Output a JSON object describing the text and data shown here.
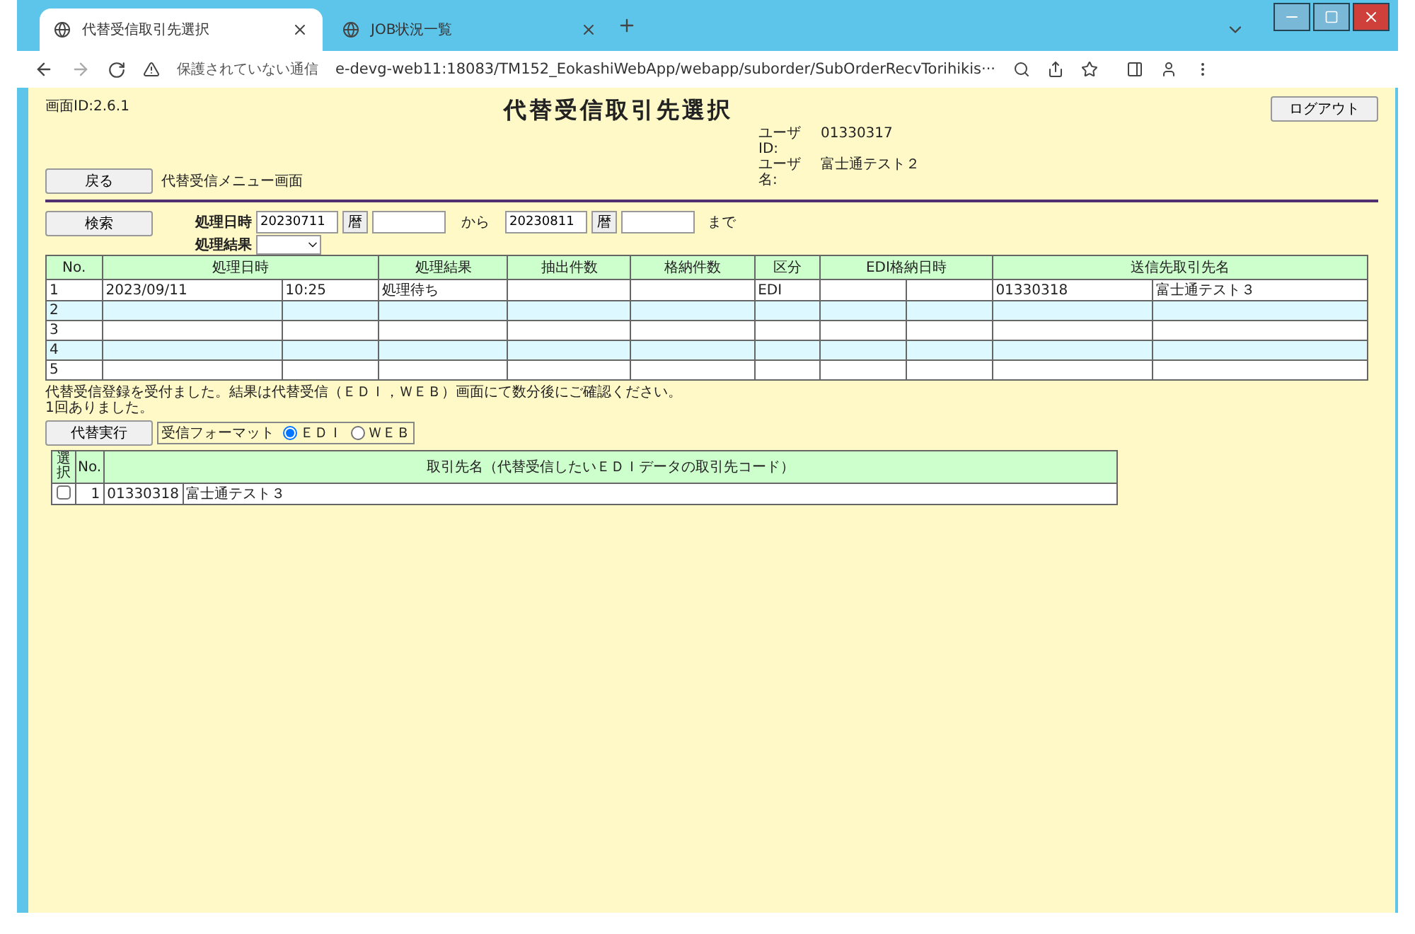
{
  "browser": {
    "tabs": [
      {
        "title": "代替受信取引先選択",
        "selected": true
      },
      {
        "title": "JOB状況一覧",
        "selected": false
      }
    ],
    "address": {
      "warning": "保護されていない通信",
      "url": "e-devg-web11:18083/TM152_EokashiWebApp/webapp/suborder/SubOrderRecvTorihikis···"
    }
  },
  "page": {
    "screen_id": "画面ID:2.6.1",
    "title": "代替受信取引先選択",
    "logout": "ログアウト",
    "user": [
      {
        "label": "ユーザID:",
        "value": "01330317"
      },
      {
        "label": "ユーザ名:",
        "value": "富士通テスト２"
      }
    ],
    "back": {
      "button": "戻る",
      "label": "代替受信メニュー画面"
    },
    "search": {
      "button": "検索",
      "date_label": "処理日時",
      "from": "20230711",
      "calendar": [
        "暦",
        "暦"
      ],
      "from_word": "から",
      "to": "20230811",
      "to_word": "まで",
      "result_label": "処理結果"
    },
    "jobs": {
      "columns": [
        "No.",
        "処理日時",
        "処理結果",
        "抽出件数",
        "格納件数",
        "区分",
        "EDI格納日時",
        "送信先取引先名"
      ],
      "rows": [
        {
          "no": "1",
          "date": "2023/09/11",
          "time": "10:25",
          "result": "処理待ち",
          "kind": "EDI",
          "code": "01330318",
          "name": "富士通テスト３"
        },
        {
          "no": "2"
        },
        {
          "no": "3"
        },
        {
          "no": "4"
        },
        {
          "no": "5"
        }
      ]
    },
    "messages": [
      "代替受信登録を受付ました。結果は代替受信（ＥＤＩ，ＷＥＢ）画面にて数分後にご確認ください。",
      "1回ありました。"
    ],
    "execute": "代替実行",
    "format_label": "受信フォーマット",
    "formats": [
      {
        "label": "ＥＤＩ",
        "selected": true
      },
      {
        "label": "ＷＥＢ",
        "selected": false
      }
    ],
    "partners": {
      "columns": [
        "選択",
        "No.",
        "取引先名（代替受信したいＥＤＩデータの取引先コード）"
      ],
      "rows": [
        {
          "checked": false,
          "no": "1",
          "code": "01330318",
          "name": "富士通テスト３"
        }
      ]
    }
  }
}
